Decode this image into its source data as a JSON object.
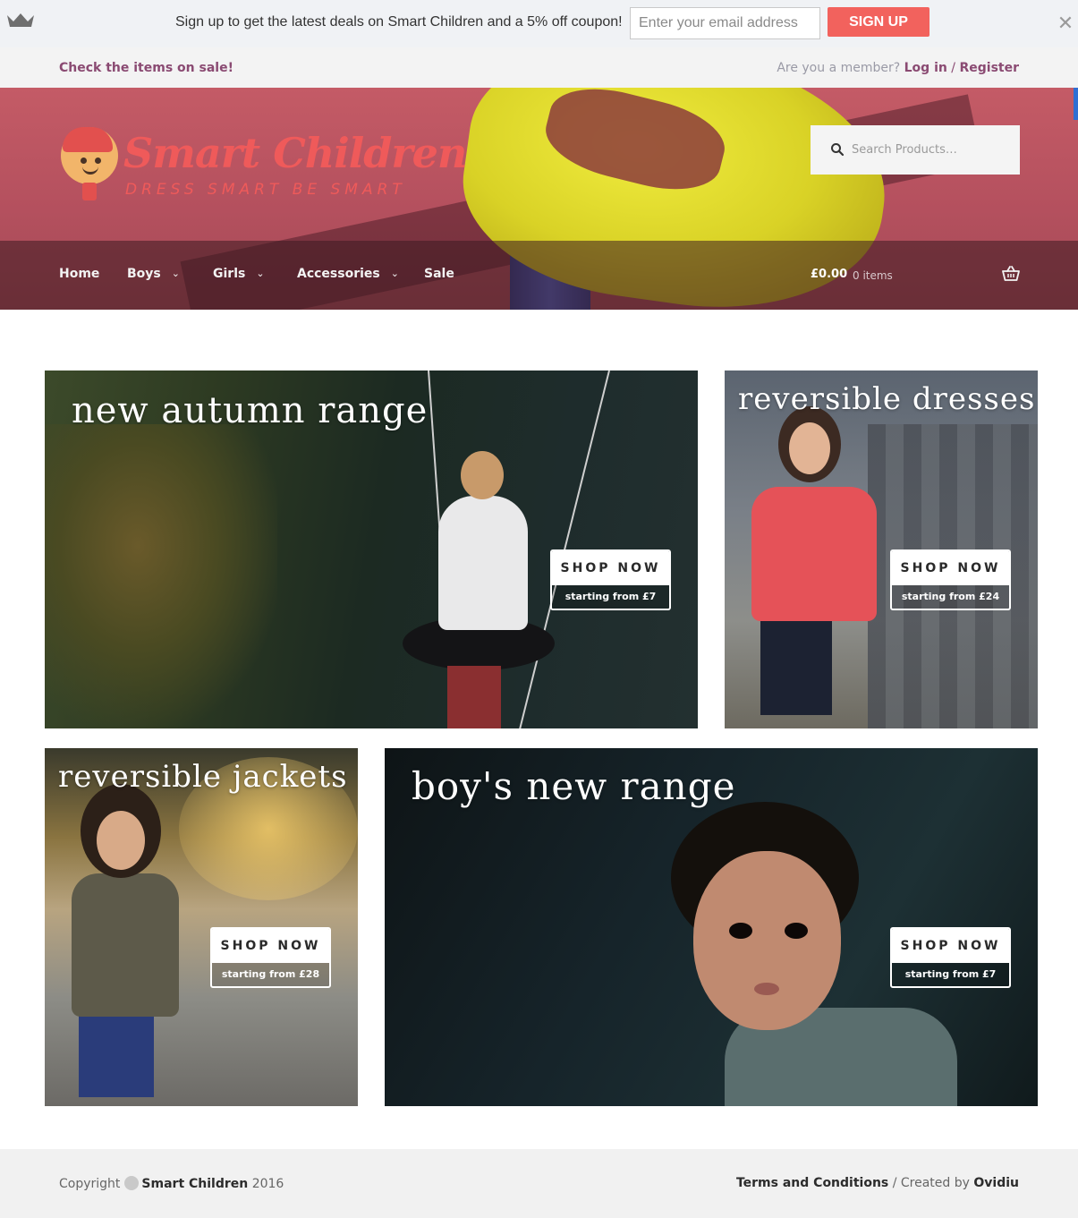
{
  "promo": {
    "text": "Sign up to get the latest deals on Smart Children and a 5% off coupon!",
    "email_placeholder": "Enter your email address",
    "signup_label": "SIGN UP",
    "close_glyph": "✕",
    "icons": {
      "left": "crown-icon",
      "close": "close-icon"
    },
    "accent": "#f2625d"
  },
  "subbar": {
    "sale_link": "Check the items on sale!",
    "member_prompt": "Are you a member?",
    "login": "Log in",
    "separator": "/",
    "register": "Register",
    "link_color": "#8a4a72"
  },
  "header": {
    "brand": "Smart Children",
    "tagline": "DRESS SMART BE SMART",
    "brand_color": "#ef5a5a",
    "search_placeholder": "Search Products…",
    "search_icon": "search-icon"
  },
  "nav": {
    "items": [
      {
        "label": "Home",
        "has_dropdown": false
      },
      {
        "label": "Boys",
        "has_dropdown": true
      },
      {
        "label": "Girls",
        "has_dropdown": true
      },
      {
        "label": "Accessories",
        "has_dropdown": true
      },
      {
        "label": "Sale",
        "has_dropdown": false
      }
    ],
    "dropdown_glyph": "⌄",
    "cart_total": "£0.00",
    "cart_count": "0 items",
    "cart_icon": "basket-icon"
  },
  "tiles": [
    {
      "title": "new autumn range",
      "cta": "SHOP NOW",
      "price": "starting from £7"
    },
    {
      "title": "reversible dresses",
      "cta": "SHOP NOW",
      "price": "starting from £24"
    },
    {
      "title": "reversible jackets",
      "cta": "SHOP NOW",
      "price": "starting from £28"
    },
    {
      "title": "boy's new range",
      "cta": "SHOP NOW",
      "price": "starting from £7"
    }
  ],
  "footer": {
    "copyright": "Copyright",
    "brand": "Smart Children",
    "year": "2016",
    "terms": "Terms and Conditions",
    "separator": "/",
    "created_by": "Created by",
    "author": "Ovidiu"
  }
}
